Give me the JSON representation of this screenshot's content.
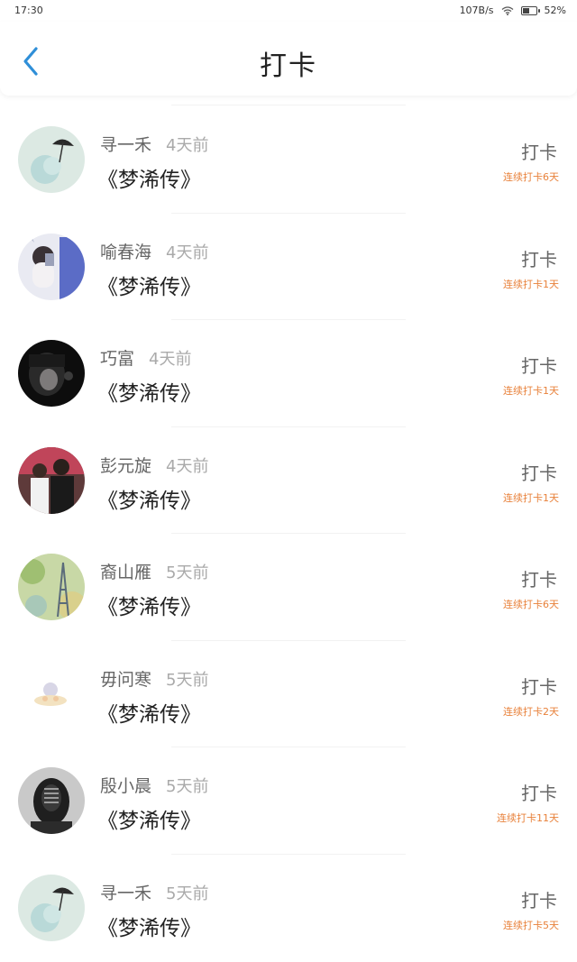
{
  "status_bar": {
    "time": "17:30",
    "net_speed": "107B/s",
    "battery": "52%",
    "battery_level": 0.52
  },
  "header": {
    "title": "打卡",
    "back_icon": "chevron-left-icon"
  },
  "colors": {
    "accent": "#2f8fd8",
    "streak": "#e8813a"
  },
  "items": [
    {
      "name": "寻一禾",
      "time": "4天前",
      "book": "《梦浠传》",
      "action": "打卡",
      "streak": "连续打卡6天"
    },
    {
      "name": "喻春海",
      "time": "4天前",
      "book": "《梦浠传》",
      "action": "打卡",
      "streak": "连续打卡1天"
    },
    {
      "name": "巧富",
      "time": "4天前",
      "book": "《梦浠传》",
      "action": "打卡",
      "streak": "连续打卡1天"
    },
    {
      "name": "彭元旋",
      "time": "4天前",
      "book": "《梦浠传》",
      "action": "打卡",
      "streak": "连续打卡1天"
    },
    {
      "name": "裔山雁",
      "time": "5天前",
      "book": "《梦浠传》",
      "action": "打卡",
      "streak": "连续打卡6天"
    },
    {
      "name": "毋问寒",
      "time": "5天前",
      "book": "《梦浠传》",
      "action": "打卡",
      "streak": "连续打卡2天"
    },
    {
      "name": "殷小晨",
      "time": "5天前",
      "book": "《梦浠传》",
      "action": "打卡",
      "streak": "连续打卡11天"
    },
    {
      "name": "寻一禾",
      "time": "5天前",
      "book": "《梦浠传》",
      "action": "打卡",
      "streak": "连续打卡5天"
    }
  ]
}
